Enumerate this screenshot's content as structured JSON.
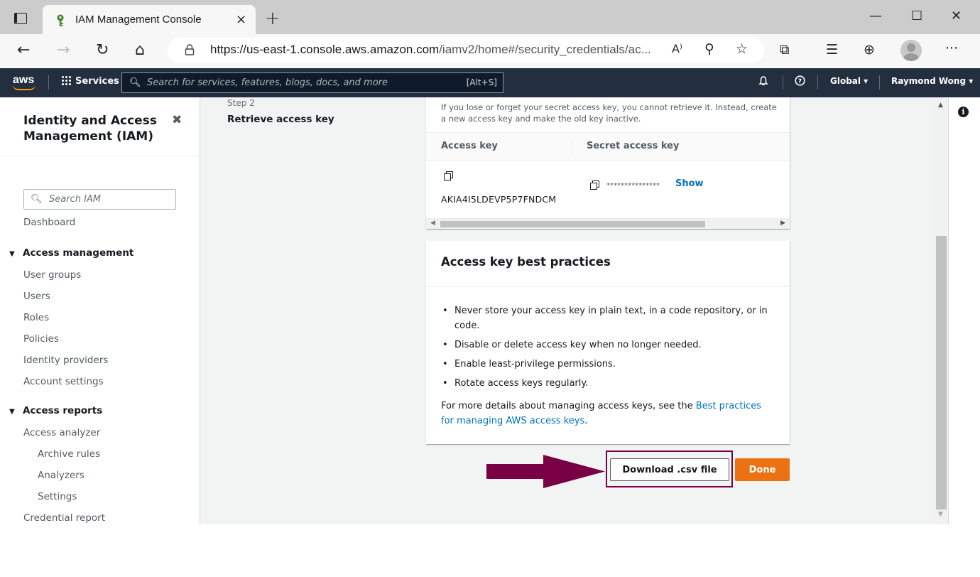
{
  "browser": {
    "tab_title": "IAM Management Console",
    "tab_close": "×",
    "new_tab": "+",
    "url_main": "https://us-east-1.console.aws.amazon.com",
    "url_path": "/iamv2/home#/security_credentials/ac...",
    "window_controls": [
      "—",
      "☐",
      "✕"
    ],
    "nav": {
      "back": "←",
      "forward": "→",
      "reload": "↻",
      "home": "⌂"
    },
    "tools": {
      "read_aloud": "A⁾",
      "zoom": "⚲",
      "favorites_add": "☆",
      "extensions": "⧉",
      "favorites": "☰",
      "collections": "⊕",
      "more": "···"
    }
  },
  "awsnav": {
    "logo": "aws",
    "services": "Services",
    "search_placeholder": "Search for services, features, blogs, docs, and more",
    "search_shortcut": "[Alt+S]",
    "bell": "🔔",
    "help": "?",
    "region": "Global ▾",
    "user": "Raymond Wong ▾"
  },
  "sidebar": {
    "title": "Identity and Access Management (IAM)",
    "close": "✖",
    "search_placeholder": "Search IAM",
    "dashboard": "Dashboard",
    "access_management": {
      "heading": "Access management",
      "items": [
        "User groups",
        "Users",
        "Roles",
        "Policies",
        "Identity providers",
        "Account settings"
      ]
    },
    "access_reports": {
      "heading": "Access reports",
      "analyzer": "Access analyzer",
      "analyzer_children": [
        "Archive rules",
        "Analyzers",
        "Settings"
      ],
      "credential_report": "Credential report"
    }
  },
  "main": {
    "step_label": "Step 2",
    "step_title": "Retrieve access key",
    "warning": "If you lose or forget your secret access key, you cannot retrieve it. Instead, create a new access key and make the old key inactive.",
    "table": {
      "col_access_key": "Access key",
      "col_secret_key": "Secret access key",
      "access_key_value": "AKIA4I5LDEVP5P7FNDCM",
      "secret_mask": "***************",
      "show_label": "Show"
    },
    "best_practices": {
      "title": "Access key best practices",
      "items": [
        "Never store your access key in plain text, in a code repository, or in code.",
        "Disable or delete access key when no longer needed.",
        "Enable least-privilege permissions.",
        "Rotate access keys regularly."
      ],
      "more_prefix": "For more details about managing access keys, see the ",
      "more_link": "Best practices for managing AWS access keys",
      "more_suffix": "."
    },
    "download_button": "Download .csv file",
    "done_button": "Done"
  },
  "colors": {
    "aws_nav_bg": "#232f3e",
    "aws_orange": "#ec7211",
    "link_blue": "#0073bb",
    "annotation_maroon": "#7a0046"
  }
}
